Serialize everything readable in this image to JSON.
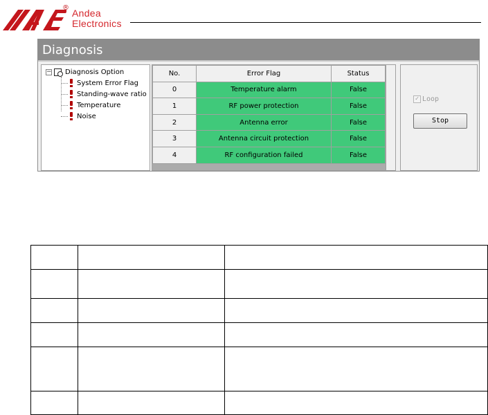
{
  "brand": {
    "name_line1": "Andea",
    "name_line2": "Electronics",
    "registered": "®",
    "logo_colors": [
      "#c4161c",
      "#d4262c"
    ]
  },
  "window": {
    "title": "Diagnosis",
    "tree": {
      "expander": "⊟",
      "root_label": "Diagnosis Option",
      "children": [
        {
          "label": "System Error Flag"
        },
        {
          "label": "Standing-wave ratio"
        },
        {
          "label": "Temperature"
        },
        {
          "label": "Noise"
        }
      ]
    },
    "grid": {
      "columns": [
        "No.",
        "Error Flag",
        "Status"
      ],
      "rows": [
        {
          "no": "0",
          "flag": "Temperature alarm",
          "status": "False"
        },
        {
          "no": "1",
          "flag": "RF power protection",
          "status": "False"
        },
        {
          "no": "2",
          "flag": "Antenna error",
          "status": "False"
        },
        {
          "no": "3",
          "flag": "Antenna circuit protection",
          "status": "False"
        },
        {
          "no": "4",
          "flag": "RF configuration failed",
          "status": "False"
        }
      ],
      "ok_color": "#40c97a"
    },
    "controls": {
      "loop_label": "Loop",
      "loop_checked": true,
      "stop_label": "Stop"
    }
  }
}
